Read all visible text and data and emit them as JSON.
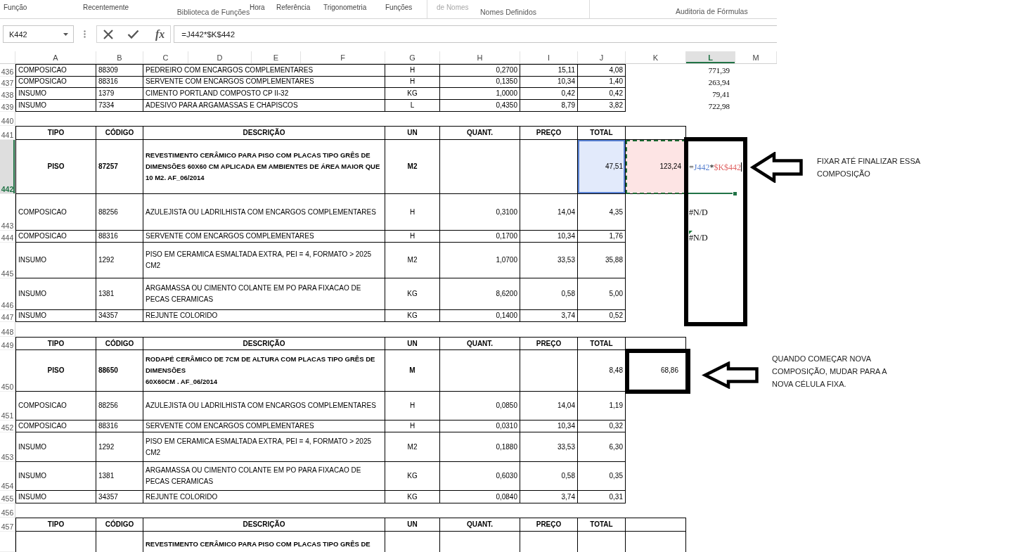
{
  "ribbon": {
    "groups": [
      {
        "label": "Biblioteca de Funções",
        "commands": [
          {
            "label": "Função",
            "disabled": false
          },
          {
            "label": "Recentemente",
            "disabled": false
          },
          {
            "label": "Hora",
            "disabled": false
          },
          {
            "label": "Referência",
            "disabled": false
          },
          {
            "label": "Trigonometria",
            "disabled": false
          },
          {
            "label": "Funções",
            "disabled": false
          }
        ]
      },
      {
        "label": "Nomes Definidos",
        "commands": [
          {
            "label": "de Nomes",
            "disabled": true
          }
        ]
      },
      {
        "label": "Auditoria de Fórmulas"
      }
    ]
  },
  "formula_bar": {
    "name_box": "K442",
    "function_button": "fx",
    "formula": "=J442*$K$442"
  },
  "columns": [
    {
      "label": "A",
      "selected": false
    },
    {
      "label": "B",
      "selected": false
    },
    {
      "label": "C",
      "selected": false
    },
    {
      "label": "D",
      "selected": false
    },
    {
      "label": "E",
      "selected": false
    },
    {
      "label": "F",
      "selected": false
    },
    {
      "label": "G",
      "selected": false
    },
    {
      "label": "H",
      "selected": false
    },
    {
      "label": "I",
      "selected": false
    },
    {
      "label": "J",
      "selected": false
    },
    {
      "label": "K",
      "selected": false
    },
    {
      "label": "L",
      "selected": true
    },
    {
      "label": "M",
      "selected": false
    }
  ],
  "rows": [
    {
      "number": "436",
      "kind": "item",
      "selected": false,
      "tipo": "COMPOSICAO",
      "codigo": "88309",
      "descricao": "PEDREIRO COM ENCARGOS COMPLEMENTARES",
      "un": "H",
      "quant": "0,2700",
      "preco": "15,11",
      "total": "4,08",
      "column_l": {
        "kind": "number",
        "text": "771,39"
      }
    },
    {
      "number": "437",
      "kind": "item",
      "selected": false,
      "tipo": "COMPOSICAO",
      "codigo": "88316",
      "descricao": "SERVENTE COM ENCARGOS COMPLEMENTARES",
      "un": "H",
      "quant": "0,1350",
      "preco": "10,34",
      "total": "1,40",
      "column_l": {
        "kind": "number",
        "text": "263,94"
      }
    },
    {
      "number": "438",
      "kind": "item",
      "selected": false,
      "tipo": "INSUMO",
      "codigo": "1379",
      "descricao": "CIMENTO PORTLAND COMPOSTO CP II-32",
      "un": "KG",
      "quant": "1,0000",
      "preco": "0,42",
      "total": "0,42",
      "column_l": {
        "kind": "number",
        "text": "79,41"
      }
    },
    {
      "number": "439",
      "kind": "item",
      "selected": false,
      "tipo": "INSUMO",
      "codigo": "7334",
      "descricao": "ADESIVO PARA ARGAMASSAS E CHAPISCOS",
      "un": "L",
      "quant": "0,4350",
      "preco": "8,79",
      "total": "3,82",
      "column_l": {
        "kind": "number",
        "text": "722,98"
      }
    },
    {
      "number": "440",
      "kind": "blank",
      "selected": false
    },
    {
      "number": "441",
      "kind": "header",
      "selected": false,
      "tipo": "TIPO",
      "codigo": "CÓDIGO",
      "descricao": "DESCRIÇÃO",
      "un": "UN",
      "quant": "QUANT.",
      "preco": "PREÇO",
      "total": "TOTAL"
    },
    {
      "number": "442",
      "kind": "main",
      "selected": true,
      "referenced": true,
      "tipo": "PISO",
      "codigo": "87257",
      "descricao": "REVESTIMENTO CERÂMICO PARA PISO COM PLACAS TIPO GRÊS DE DIMENSÕES 60X60 CM APLICADA EM AMBIENTES DE ÁREA MAIOR QUE 10 M2. AF_06/2014",
      "un": "M2",
      "total": "47,51",
      "column_k": "123,24",
      "column_l": {
        "kind": "edit",
        "parts": [
          {
            "text": "="
          },
          {
            "text": "J442",
            "color": "#5a82d0"
          },
          {
            "text": "*"
          },
          {
            "text": "$K$442",
            "color": "#e06464"
          }
        ]
      }
    },
    {
      "number": "443",
      "kind": "item",
      "selected": false,
      "tipo": "COMPOSICAO",
      "codigo": "88256",
      "descricao": "AZULEJISTA OU LADRILHISTA COM ENCARGOS COMPLEMENTARES",
      "un": "H",
      "quant": "0,3100",
      "preco": "14,04",
      "total": "4,35",
      "column_l": {
        "kind": "error",
        "text": "#N/D",
        "flagged": false
      }
    },
    {
      "number": "444",
      "kind": "item",
      "selected": false,
      "tipo": "COMPOSICAO",
      "codigo": "88316",
      "descricao": "SERVENTE COM ENCARGOS COMPLEMENTARES",
      "un": "H",
      "quant": "0,1700",
      "preco": "10,34",
      "total": "1,76",
      "column_l": {
        "kind": "error",
        "text": "#N/D",
        "flagged": true
      }
    },
    {
      "number": "445",
      "kind": "item",
      "selected": false,
      "tipo": "INSUMO",
      "codigo": "1292",
      "descricao": "PISO EM CERAMICA ESMALTADA EXTRA, PEI = 4, FORMATO > 2025 CM2",
      "un": "M2",
      "quant": "1,0700",
      "preco": "33,53",
      "total": "35,88"
    },
    {
      "number": "446",
      "kind": "item",
      "selected": false,
      "tipo": "INSUMO",
      "codigo": "1381",
      "descricao": "ARGAMASSA OU CIMENTO COLANTE EM PO PARA FIXACAO DE PECAS CERAMICAS",
      "un": "KG",
      "quant": "8,6200",
      "preco": "0,58",
      "total": "5,00"
    },
    {
      "number": "447",
      "kind": "item",
      "selected": false,
      "tipo": "INSUMO",
      "codigo": "34357",
      "descricao": "REJUNTE COLORIDO",
      "un": "KG",
      "quant": "0,1400",
      "preco": "3,74",
      "total": "0,52"
    },
    {
      "number": "448",
      "kind": "blank",
      "selected": false
    },
    {
      "number": "449",
      "kind": "header",
      "selected": false,
      "tipo": "TIPO",
      "codigo": "CÓDIGO",
      "descricao": "DESCRIÇÃO",
      "un": "UN",
      "quant": "QUANT.",
      "preco": "PREÇO",
      "total": "TOTAL"
    },
    {
      "number": "450",
      "kind": "main",
      "selected": false,
      "referenced": false,
      "tipo": "PISO",
      "codigo": "88650",
      "descricao": "RODAPÉ CERÂMICO DE 7CM DE ALTURA COM PLACAS TIPO GRÊS DE DIMENSÕES\n60X60CM . AF_06/2014",
      "un": "M",
      "total": "8,48",
      "column_k": "68,86"
    },
    {
      "number": "451",
      "kind": "item",
      "selected": false,
      "tipo": "COMPOSICAO",
      "codigo": "88256",
      "descricao": "AZULEJISTA OU LADRILHISTA COM ENCARGOS COMPLEMENTARES",
      "un": "H",
      "quant": "0,0850",
      "preco": "14,04",
      "total": "1,19"
    },
    {
      "number": "452",
      "kind": "item",
      "selected": false,
      "tipo": "COMPOSICAO",
      "codigo": "88316",
      "descricao": "SERVENTE COM ENCARGOS COMPLEMENTARES",
      "un": "H",
      "quant": "0,0310",
      "preco": "10,34",
      "total": "0,32"
    },
    {
      "number": "453",
      "kind": "item",
      "selected": false,
      "tipo": "INSUMO",
      "codigo": "1292",
      "descricao": "PISO EM CERAMICA ESMALTADA EXTRA, PEI = 4, FORMATO > 2025 CM2",
      "un": "M2",
      "quant": "0,1880",
      "preco": "33,53",
      "total": "6,30"
    },
    {
      "number": "454",
      "kind": "item",
      "selected": false,
      "tipo": "INSUMO",
      "codigo": "1381",
      "descricao": "ARGAMASSA OU CIMENTO COLANTE EM PO PARA FIXACAO DE PECAS CERAMICAS",
      "un": "KG",
      "quant": "0,6030",
      "preco": "0,58",
      "total": "0,35"
    },
    {
      "number": "455",
      "kind": "item",
      "selected": false,
      "tipo": "INSUMO",
      "codigo": "34357",
      "descricao": "REJUNTE COLORIDO",
      "un": "KG",
      "quant": "0,0840",
      "preco": "3,74",
      "total": "0,31"
    },
    {
      "number": "456",
      "kind": "blank",
      "selected": false
    },
    {
      "number": "457",
      "kind": "header",
      "selected": false,
      "tipo": "TIPO",
      "codigo": "CÓDIGO",
      "descricao": "DESCRIÇÃO",
      "un": "UN",
      "quant": "QUANT.",
      "preco": "PREÇO",
      "total": "TOTAL"
    },
    {
      "kind": "main",
      "referenced": false,
      "descricao": "REVESTIMENTO CERÂMICO PARA PISO COM PLACAS TIPO GRÊS DE"
    }
  ],
  "annotations": [
    {
      "note": "FIXAR ATÉ FINALIZAR ESSA COMPOSIÇÃO"
    },
    {
      "note": "QUANDO COMEÇAR NOVA COMPOSIÇÃO, MUDAR PARA A NOVA CÉLULA FIXA."
    }
  ]
}
